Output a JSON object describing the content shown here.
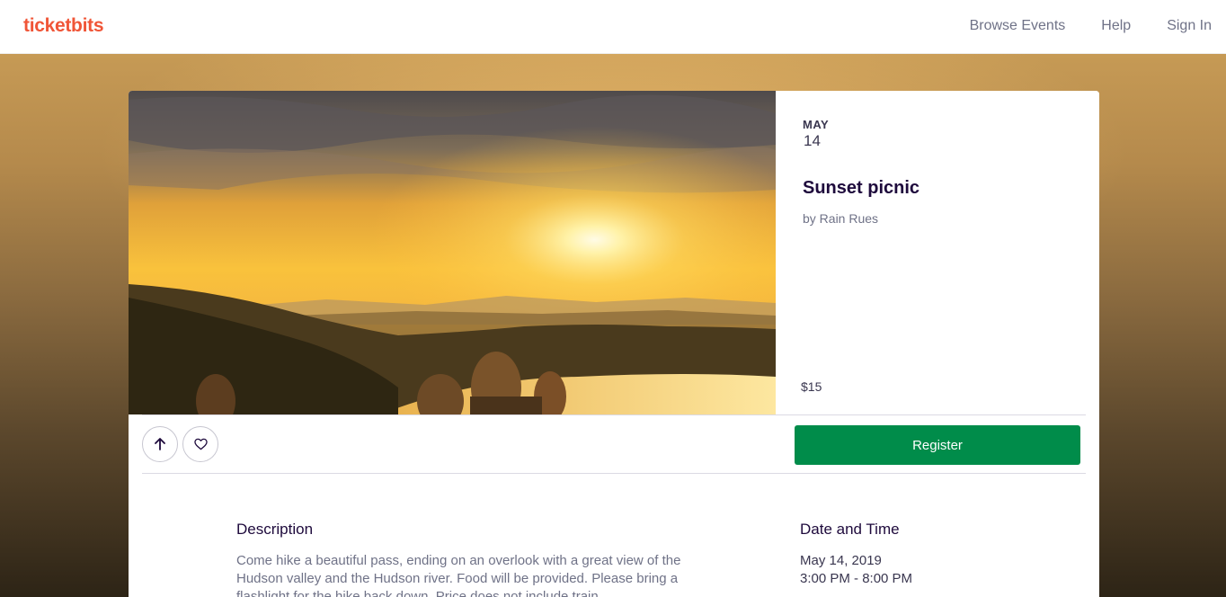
{
  "header": {
    "brand": "ticketbits",
    "nav": [
      "Browse Events",
      "Help",
      "Sign In"
    ]
  },
  "event": {
    "month": "MAY",
    "day": "14",
    "title": "Sunset picnic",
    "organizer": "by Rain Rues",
    "price": "$15"
  },
  "actions": {
    "share_icon": "arrow-up-icon",
    "like_icon": "heart-icon",
    "register_label": "Register"
  },
  "details": {
    "description_title": "Description",
    "description_text": "Come hike a beautiful pass, ending on an overlook with a great view of the Hudson valley and the Hudson river. Food will be provided. Please bring a flashlight for the hike back down. Price does not include train",
    "datetime_title": "Date and Time",
    "date": "May 14, 2019",
    "time": "3:00 PM - 8:00 PM"
  },
  "colors": {
    "brand": "#f05537",
    "register": "#008c4a",
    "title": "#1e0a3c"
  }
}
